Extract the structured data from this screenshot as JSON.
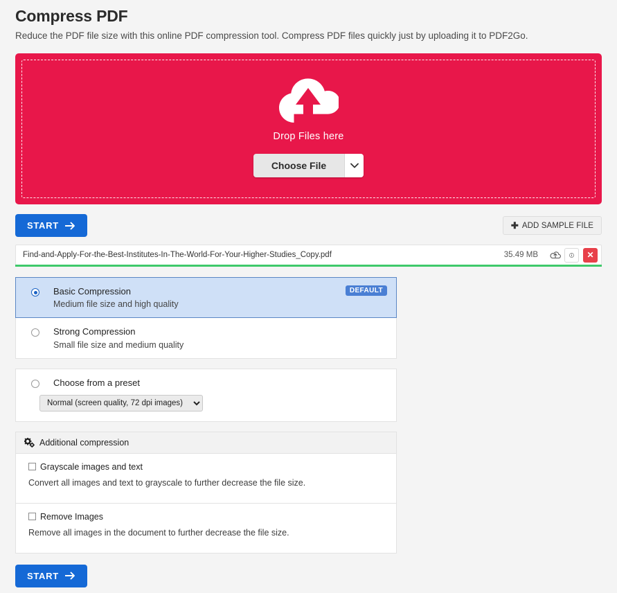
{
  "header": {
    "title": "Compress PDF",
    "subtitle": "Reduce the PDF file size with this online PDF compression tool. Compress PDF files quickly just by uploading it to PDF2Go."
  },
  "dropzone": {
    "icon": "cloud-upload-icon",
    "label": "Drop Files here",
    "choose_file_label": "Choose File",
    "caret_icon": "chevron-down-icon",
    "background_color": "#e8174a"
  },
  "actions": {
    "start_label": "START",
    "start_arrow_icon": "arrow-right-icon",
    "start_color": "#1569d6",
    "add_sample_label": "ADD SAMPLE FILE",
    "add_sample_icon": "plus-icon"
  },
  "file": {
    "name": "Find-and-Apply-For-the-Best-Institutes-In-The-World-For-Your-Higher-Studies_Copy.pdf",
    "size": "35.49 MB",
    "upload_icon": "cloud-upload-small-icon",
    "info_icon": "info-circle-icon",
    "delete_icon": "close-x-icon",
    "progress_percent": 100,
    "progress_color": "#3ec96a"
  },
  "compression_options": [
    {
      "title": "Basic Compression",
      "description": "Medium file size and high quality",
      "selected": true,
      "badge": "DEFAULT"
    },
    {
      "title": "Strong Compression",
      "description": "Small file size and medium quality",
      "selected": false,
      "badge": ""
    }
  ],
  "preset": {
    "title": "Choose from a preset",
    "selected": false,
    "selected_value": "Normal (screen quality, 72 dpi images)",
    "options": [
      "Normal (screen quality, 72 dpi images)"
    ]
  },
  "additional": {
    "header": "Additional compression",
    "header_icon": "cogs-icon",
    "checkboxes": [
      {
        "label": "Grayscale images and text",
        "description": "Convert all images and text to grayscale to further decrease the file size.",
        "checked": false
      },
      {
        "label": "Remove Images",
        "description": "Remove all images in the document to further decrease the file size.",
        "checked": false
      }
    ]
  },
  "bottom": {
    "start_label": "START"
  }
}
